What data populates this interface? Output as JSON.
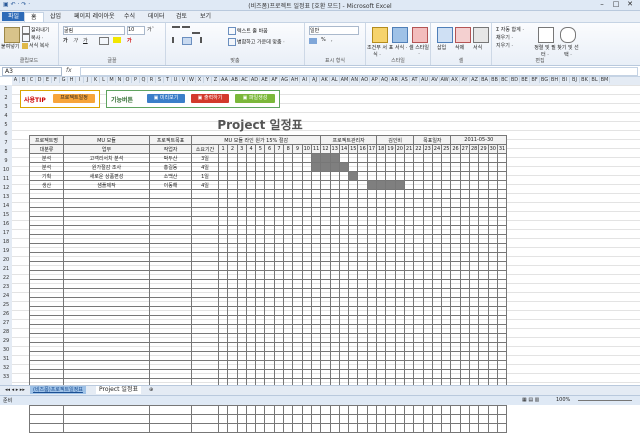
{
  "window": {
    "title": "(비즈폼)프로젝트 일정표 [호환 모드] - Microsoft Excel",
    "quick_access": "▣ ↶ · ↷ ·"
  },
  "tabs": [
    "파일",
    "홈",
    "삽입",
    "페이지 레이아웃",
    "수식",
    "데이터",
    "검토",
    "보기"
  ],
  "ribbon": {
    "clipboard": {
      "paste": "붙여넣기",
      "cut": "잘라내기",
      "copy": "복사 ·",
      "format_painter": "서식 복사",
      "label": "클립보드"
    },
    "font": {
      "name": "굴림",
      "size": "10",
      "label": "글꼴",
      "bold": "가",
      "italic": "가",
      "underline": "가",
      "grow": "가ˆ",
      "shrink": "가ˇ"
    },
    "align": {
      "wrap": "텍스트 줄 바꿈",
      "merge": "병합하고 가운데 맞춤 ·",
      "label": "맞춤"
    },
    "number": {
      "format": "일반",
      "pct": "%",
      "comma": ",",
      "label": "표시 형식"
    },
    "styles": {
      "cond": "조건부 서식 ·",
      "table": "표 서식 ·",
      "cell": "셀 스타일 ·",
      "label": "스타일"
    },
    "cells": {
      "insert": "삽입",
      "delete": "삭제",
      "format": "서식",
      "label": "셀"
    },
    "edit": {
      "sum": "Σ 자동 합계 ·",
      "fill": "채우기 ·",
      "clear": "지우기 ·",
      "sort": "정렬 및 필터 ·",
      "find": "찾기 및 선택 ·",
      "label": "편집"
    }
  },
  "formula_bar": {
    "name_box": "A3",
    "fx": "fx",
    "value": ""
  },
  "columns": [
    "A",
    "B",
    "C",
    "D",
    "E",
    "F",
    "G",
    "H",
    "I",
    "J",
    "K",
    "L",
    "M",
    "N",
    "O",
    "P",
    "Q",
    "R",
    "S",
    "T",
    "U",
    "V",
    "W",
    "X",
    "Y",
    "Z",
    "AA",
    "AB",
    "AC",
    "AD",
    "AE",
    "AF",
    "AG",
    "AH",
    "AI",
    "AJ",
    "AK",
    "AL",
    "AM",
    "AN",
    "AO",
    "AP",
    "AQ",
    "AR",
    "AS",
    "AT",
    "AU",
    "AV",
    "AW",
    "AX",
    "AY",
    "AZ",
    "BA",
    "BB",
    "BC",
    "BD",
    "BE",
    "BF",
    "BG",
    "BH",
    "BI",
    "BJ",
    "BK",
    "BL",
    "BM"
  ],
  "rows": [
    "1",
    "2",
    "3",
    "4",
    "5",
    "6",
    "7",
    "8",
    "9",
    "10",
    "11",
    "12",
    "13",
    "14",
    "15",
    "16",
    "17",
    "18",
    "19",
    "20",
    "21",
    "22",
    "23",
    "24",
    "25",
    "26",
    "27",
    "28",
    "29",
    "30",
    "31",
    "32",
    "33"
  ],
  "tip": {
    "label": "사용TIP",
    "button": "프로젝트일정"
  },
  "func": {
    "label": "기능버튼",
    "preview": "미리보기",
    "print": "출력하기",
    "new": "파일생성"
  },
  "project": {
    "title": "Project 일정표",
    "meta": {
      "name_label": "프로젝트명",
      "name": "MU 모듈",
      "goal_label": "프로젝트목표",
      "goal": "MU 모듈 라인 원가 15% 절감",
      "mgr_label": "프로젝트관리자",
      "mgr": "김인비",
      "date_label": "목표일자",
      "date": "2011-05-30"
    },
    "headers": {
      "category": "대분류",
      "task": "업무",
      "owner": "작업자",
      "duration": "소요기간"
    },
    "days": [
      "1",
      "2",
      "3",
      "4",
      "5",
      "6",
      "7",
      "8",
      "9",
      "10",
      "11",
      "12",
      "13",
      "14",
      "15",
      "16",
      "17",
      "18",
      "19",
      "20",
      "21",
      "22",
      "23",
      "24",
      "25",
      "26",
      "27",
      "28",
      "29",
      "30",
      "31"
    ],
    "tasks": [
      {
        "category": "분석",
        "task": "고객리서치 분석",
        "owner": "박두산",
        "duration": "3일",
        "start": 11,
        "end": 13
      },
      {
        "category": "분석",
        "task": "원가절감 조사",
        "owner": "홍길동",
        "duration": "4일",
        "start": 11,
        "end": 14
      },
      {
        "category": "기획",
        "task": "새로운 상품편성",
        "owner": "소백산",
        "duration": "1일",
        "start": 15,
        "end": 15
      },
      {
        "category": "생산",
        "task": "샘플제작",
        "owner": "이동해",
        "duration": "4일",
        "start": 17,
        "end": 20
      }
    ]
  },
  "sheet_tabs": {
    "active": "(비즈폼)프로젝트일정표",
    "other": "Project 일정표"
  },
  "status": {
    "ready": "준비",
    "zoom": "100%"
  }
}
